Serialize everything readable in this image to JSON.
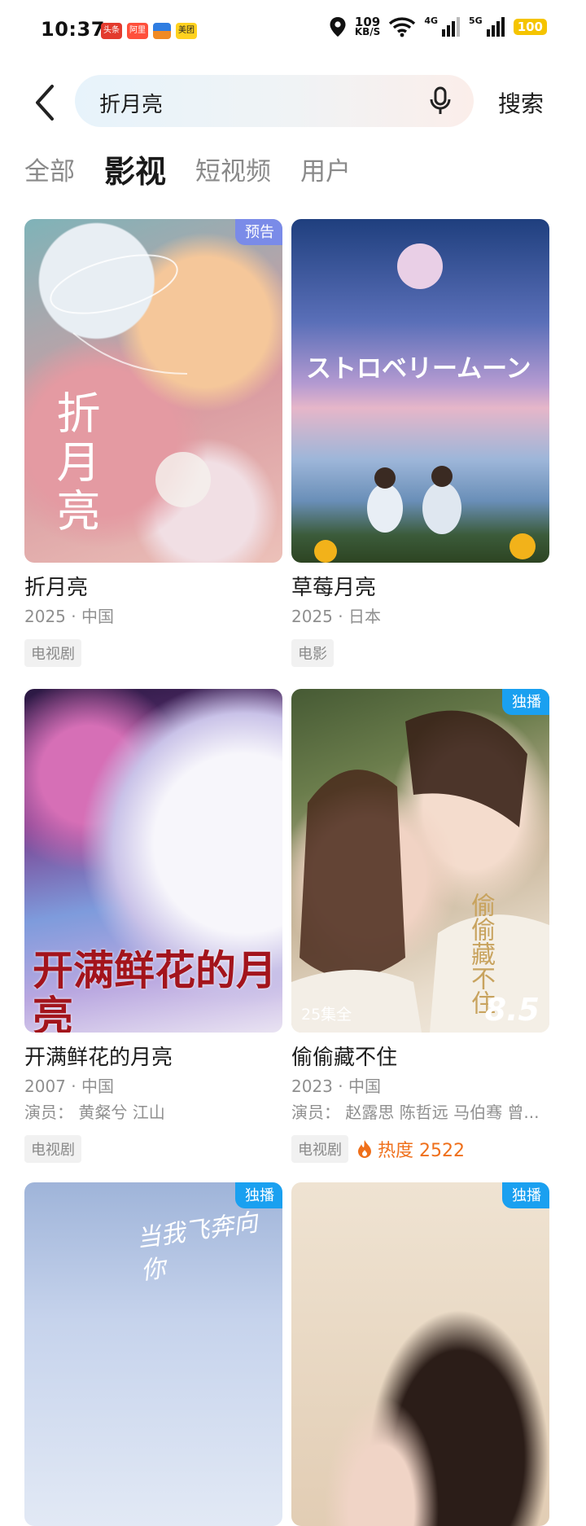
{
  "status_bar": {
    "time": "10:37",
    "app_badges": [
      "头条",
      "阿里",
      "",
      "美团"
    ],
    "speed_value": "109",
    "speed_unit": "KB/S",
    "network_1": "4G",
    "network_2": "5G",
    "battery": "100",
    "icons": [
      "location-icon",
      "wifi-icon",
      "signal-icon",
      "battery-icon"
    ]
  },
  "header": {
    "search_value": "折月亮",
    "search_button": "搜索"
  },
  "tabs": [
    {
      "label": "全部",
      "active": false
    },
    {
      "label": "影视",
      "active": true
    },
    {
      "label": "短视频",
      "active": false
    },
    {
      "label": "用户",
      "active": false
    }
  ],
  "results": [
    {
      "title": "折月亮",
      "meta": "2025 · 中国",
      "type": "电视剧",
      "corner_tag": "预告",
      "poster_text": "折月亮"
    },
    {
      "title": "草莓月亮",
      "meta": "2025 · 日本",
      "type": "电影",
      "poster_text": "ストロベリームーン"
    },
    {
      "title": "开满鲜花的月亮",
      "meta": "2007 · 中国",
      "cast": "演员：  黄粲兮 江山",
      "type": "电视剧",
      "poster_text": "开满鲜花的月亮"
    },
    {
      "title": "偷偷藏不住",
      "meta": "2023 · 中国",
      "cast": "演员：  赵露思 陈哲远 马伯骞 曾...",
      "type": "电视剧",
      "corner_tag": "独播",
      "episodes": "25集全",
      "score": "8.5",
      "heat": "热度 2522",
      "poster_text": "偷偷藏不住"
    },
    {
      "corner_tag": "独播",
      "poster_text": "当我飞奔向你"
    },
    {
      "corner_tag": "独播"
    }
  ],
  "colors": {
    "preview_tag": "#7a8be8",
    "exclusive_tag": "#1aa0f0",
    "heat": "#ef6f1a"
  }
}
